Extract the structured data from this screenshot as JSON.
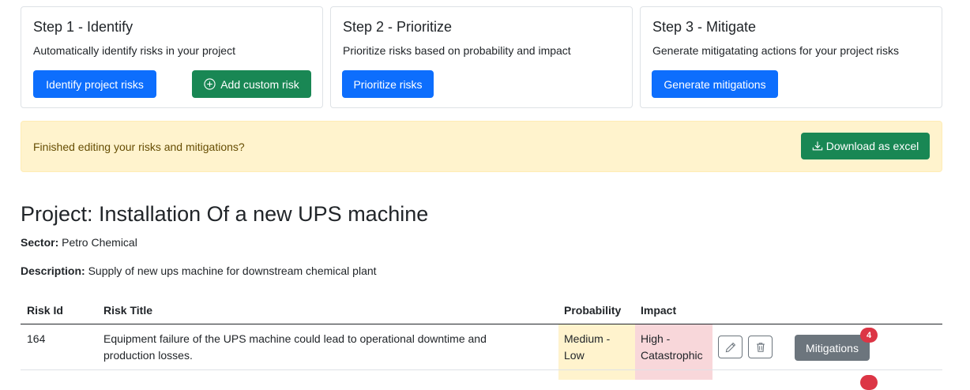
{
  "steps": [
    {
      "title": "Step 1 - Identify",
      "description": "Automatically identify risks in your project",
      "primary_button": "Identify project risks",
      "secondary_button": "Add custom risk"
    },
    {
      "title": "Step 2 - Prioritize",
      "description": "Prioritize risks based on probability and impact",
      "primary_button": "Prioritize risks"
    },
    {
      "title": "Step 3 - Mitigate",
      "description": "Generate mitigatating actions for your project risks",
      "primary_button": "Generate mitigations"
    }
  ],
  "alert": {
    "message": "Finished editing your risks and mitigations?",
    "download_button": "Download as excel"
  },
  "project": {
    "title": "Project: Installation Of a new UPS machine",
    "sector_label": "Sector:",
    "sector": "Petro Chemical",
    "description_label": "Description:",
    "description": "Supply of new ups machine for downstream chemical plant"
  },
  "table": {
    "headers": {
      "risk_id": "Risk Id",
      "risk_title": "Risk Title",
      "probability": "Probability",
      "impact": "Impact"
    },
    "rows": [
      {
        "risk_id": "164",
        "risk_title": "Equipment failure of the UPS machine could lead to operational downtime and production losses.",
        "probability": "Medium - Low",
        "impact": "High - Catastrophic",
        "mitigations_label": "Mitigations",
        "mitigations_count": "4"
      }
    ]
  },
  "colors": {
    "primary": "#0d6efd",
    "success": "#198754",
    "secondary": "#6c757d",
    "warning_bg": "#fff3cd",
    "danger_bg": "#f8d7da",
    "badge": "#dc3545"
  }
}
